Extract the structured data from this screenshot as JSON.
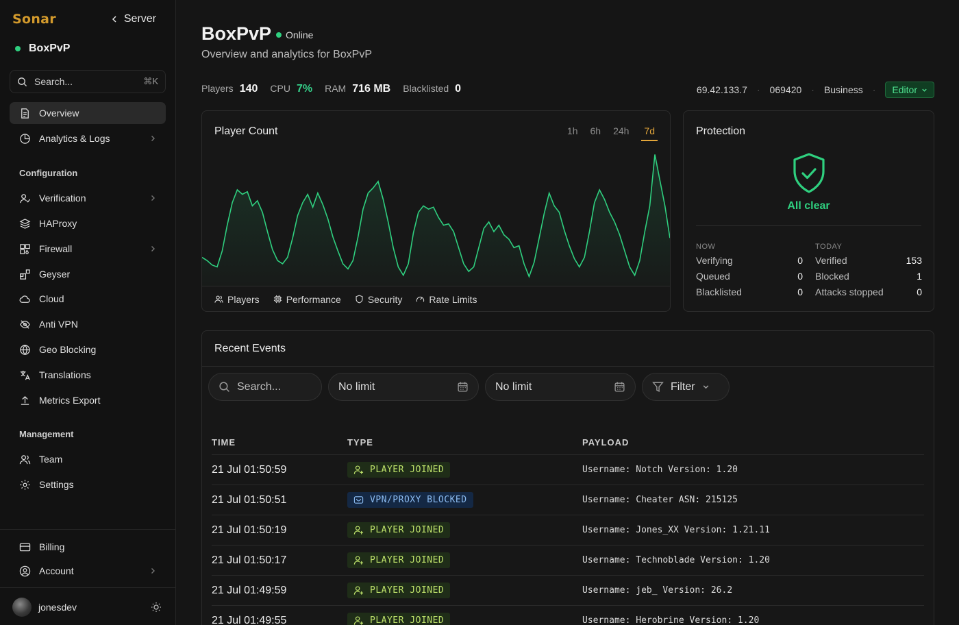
{
  "sidebar": {
    "brand": "Sonar",
    "back_label": "Server",
    "server_name": "BoxPvP",
    "search_placeholder": "Search...",
    "search_shortcut": "⌘K",
    "items": [
      {
        "label": "Overview",
        "icon": "document-icon"
      },
      {
        "label": "Analytics & Logs",
        "icon": "pie-chart-icon"
      }
    ],
    "config_title": "Configuration",
    "config_items": [
      {
        "label": "Verification",
        "icon": "user-check-icon"
      },
      {
        "label": "HAProxy",
        "icon": "layers-icon"
      },
      {
        "label": "Firewall",
        "icon": "firewall-icon"
      },
      {
        "label": "Geyser",
        "icon": "blocks-icon"
      },
      {
        "label": "Cloud",
        "icon": "cloud-icon"
      },
      {
        "label": "Anti VPN",
        "icon": "eye-off-icon"
      },
      {
        "label": "Geo Blocking",
        "icon": "globe-icon"
      },
      {
        "label": "Translations",
        "icon": "languages-icon"
      },
      {
        "label": "Metrics Export",
        "icon": "upload-icon"
      }
    ],
    "manage_title": "Management",
    "manage_items": [
      {
        "label": "Team",
        "icon": "users-icon"
      },
      {
        "label": "Settings",
        "icon": "gear-icon"
      }
    ],
    "bottom_items": [
      {
        "label": "Billing",
        "icon": "credit-card-icon"
      },
      {
        "label": "Account",
        "icon": "user-circle-icon"
      }
    ],
    "username": "jonesdev"
  },
  "header": {
    "title": "BoxPvP",
    "status": "Online",
    "subtitle": "Overview and analytics for BoxPvP"
  },
  "stats": {
    "players_label": "Players",
    "players": "140",
    "cpu_label": "CPU",
    "cpu": "7%",
    "ram_label": "RAM",
    "ram": "716 MB",
    "blacklisted_label": "Blacklisted",
    "blacklisted": "0"
  },
  "meta": {
    "ip": "69.42.133.7",
    "id": "069420",
    "plan": "Business",
    "role": "Editor"
  },
  "player_card": {
    "title": "Player Count",
    "ranges": [
      "1h",
      "6h",
      "24h",
      "7d"
    ],
    "active_range": "7d",
    "tabs": [
      "Players",
      "Performance",
      "Security",
      "Rate Limits"
    ]
  },
  "chart_data": {
    "type": "area",
    "title": "Player Count",
    "values": [
      40,
      35,
      28,
      25,
      50,
      90,
      125,
      145,
      138,
      142,
      120,
      128,
      110,
      80,
      52,
      35,
      30,
      40,
      70,
      105,
      125,
      138,
      118,
      140,
      122,
      100,
      72,
      50,
      30,
      22,
      35,
      72,
      115,
      140,
      148,
      158,
      130,
      95,
      55,
      25,
      12,
      30,
      78,
      110,
      120,
      115,
      118,
      102,
      90,
      92,
      80,
      55,
      30,
      18,
      25,
      55,
      85,
      95,
      80,
      90,
      75,
      68,
      55,
      58,
      30,
      10,
      32,
      70,
      108,
      140,
      120,
      110,
      82,
      58,
      38,
      25,
      40,
      80,
      125,
      145,
      130,
      110,
      95,
      75,
      50,
      25,
      12,
      35,
      80,
      120,
      200,
      160,
      120,
      70
    ],
    "ylim": [
      0,
      210
    ],
    "grid": false,
    "legend": "none",
    "line_color": "#2fcf7f"
  },
  "protection": {
    "title": "Protection",
    "status": "All clear",
    "now_label": "NOW",
    "today_label": "TODAY",
    "now": [
      {
        "label": "Verifying",
        "value": "0"
      },
      {
        "label": "Queued",
        "value": "0"
      },
      {
        "label": "Blacklisted",
        "value": "0"
      }
    ],
    "today": [
      {
        "label": "Verified",
        "value": "153"
      },
      {
        "label": "Blocked",
        "value": "1"
      },
      {
        "label": "Attacks stopped",
        "value": "0"
      }
    ]
  },
  "events": {
    "title": "Recent Events",
    "search_placeholder": "Search...",
    "date_from": "No limit",
    "date_to": "No limit",
    "filter_label": "Filter",
    "columns": [
      "TIME",
      "TYPE",
      "PAYLOAD"
    ],
    "rows": [
      {
        "time": "21 Jul 01:50:59",
        "type": "PLAYER JOINED",
        "kind": "join",
        "payload": "Username: Notch Version: 1.20"
      },
      {
        "time": "21 Jul 01:50:51",
        "type": "VPN/PROXY BLOCKED",
        "kind": "vpn",
        "payload": "Username: Cheater ASN: 215125"
      },
      {
        "time": "21 Jul 01:50:19",
        "type": "PLAYER JOINED",
        "kind": "join",
        "payload": "Username: Jones_XX Version: 1.21.11"
      },
      {
        "time": "21 Jul 01:50:17",
        "type": "PLAYER JOINED",
        "kind": "join",
        "payload": "Username: Technoblade Version: 1.20"
      },
      {
        "time": "21 Jul 01:49:59",
        "type": "PLAYER JOINED",
        "kind": "join",
        "payload": "Username: jeb_ Version: 26.2"
      },
      {
        "time": "21 Jul 01:49:55",
        "type": "PLAYER JOINED",
        "kind": "join",
        "payload": "Username: Herobrine Version: 1.20"
      }
    ]
  }
}
